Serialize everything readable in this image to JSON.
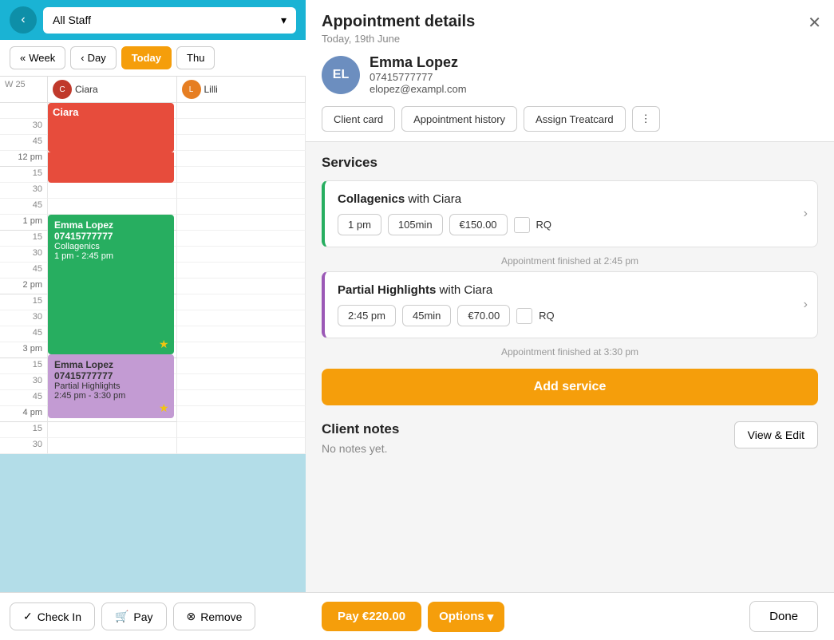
{
  "left": {
    "back_icon": "‹",
    "staff_dropdown": {
      "label": "All Staff",
      "chevron": "▾"
    },
    "nav": {
      "week_label": "Week",
      "week_icon": "«",
      "day_label": "Day",
      "day_icon": "‹",
      "today_label": "Today",
      "thu_label": "Thu"
    },
    "calendar": {
      "week_label": "W 25",
      "staff1_name": "Ciara",
      "staff2_name": "Lilli"
    },
    "time_rows": [
      {
        "label": "",
        "major": false
      },
      {
        "label": "30",
        "major": false
      },
      {
        "label": "45",
        "major": false
      },
      {
        "label": "12 pm",
        "major": true
      },
      {
        "label": "15",
        "major": false
      },
      {
        "label": "30",
        "major": false
      },
      {
        "label": "45",
        "major": false
      },
      {
        "label": "1 pm",
        "major": true
      },
      {
        "label": "15",
        "major": false
      },
      {
        "label": "30",
        "major": false
      },
      {
        "label": "45",
        "major": false
      },
      {
        "label": "2 pm",
        "major": true
      },
      {
        "label": "15",
        "major": false
      },
      {
        "label": "30",
        "major": false
      },
      {
        "label": "45",
        "major": false
      },
      {
        "label": "3 pm",
        "major": true
      },
      {
        "label": "15",
        "major": false
      },
      {
        "label": "30",
        "major": false
      },
      {
        "label": "45",
        "major": false
      },
      {
        "label": "4 pm",
        "major": true
      },
      {
        "label": "15",
        "major": false
      },
      {
        "label": "30",
        "major": false
      }
    ],
    "appointments": {
      "ciara_block": {
        "name": "Ciara",
        "color": "#e74c3c"
      },
      "emma_green": {
        "name": "Emma Lopez 07415777777",
        "service": "Collagenics",
        "time": "1 pm - 2:45 pm",
        "color": "#27ae60"
      },
      "emma_purple": {
        "name": "Emma Lopez 07415777777",
        "service": "Partial Highlights",
        "time": "2:45 pm - 3:30 pm",
        "color": "#c39bd3"
      }
    },
    "bottom": {
      "checkin_icon": "✓",
      "checkin_label": "Check In",
      "pay_icon": "🛒",
      "pay_label": "Pay",
      "remove_icon": "⊗",
      "remove_label": "Remove"
    }
  },
  "right": {
    "title": "Appointment details",
    "date": "Today, 19th June",
    "close_icon": "✕",
    "client": {
      "initials": "EL",
      "name": "Emma Lopez",
      "phone": "07415777777",
      "email": "elopez@exampl.com"
    },
    "actions": {
      "client_card": "Client card",
      "appt_history": "Appointment history",
      "assign_treatcard": "Assign Treatcard",
      "more_icon": "⋮"
    },
    "services": {
      "section_title": "Services",
      "items": [
        {
          "name": "Collagenics",
          "provider": "with Ciara",
          "time": "1 pm",
          "duration": "105min",
          "price": "€150.00",
          "rq": "RQ",
          "border_color": "#27ae60",
          "finished": "Appointment finished at 2:45 pm"
        },
        {
          "name": "Partial Highlights",
          "provider": "with Ciara",
          "time": "2:45 pm",
          "duration": "45min",
          "price": "€70.00",
          "rq": "RQ",
          "border_color": "#9b59b6",
          "finished": "Appointment finished at 3:30 pm"
        }
      ],
      "add_service_label": "Add service"
    },
    "client_notes": {
      "title": "Client notes",
      "text": "No notes yet.",
      "view_edit_label": "View & Edit"
    },
    "bottom": {
      "pay_label": "Pay €220.00",
      "options_label": "Options",
      "options_chevron": "▾",
      "done_label": "Done"
    }
  }
}
